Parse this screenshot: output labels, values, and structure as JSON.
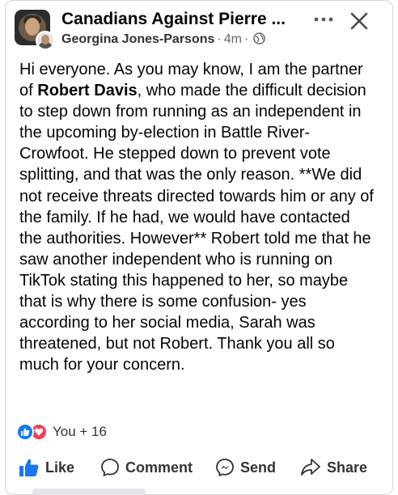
{
  "post": {
    "group_name": "Canadians Against Pierre ...",
    "author": "Georgina Jones-Parsons",
    "separator": "·",
    "time": "4m",
    "time_separator": "·",
    "privacy_icon": "globe-icon",
    "more_icon": "more-horizontal-icon",
    "close_icon": "close-icon",
    "text_before_bold": "Hi everyone. As you may know, I am the partner of ",
    "bold_name": "Robert Davis",
    "text_after_bold": ", who made the difficult decision to step down from running as an independent in the upcoming by-election in Battle River-Crowfoot. He stepped down to prevent vote splitting, and that was the only reason. **We did not receive threats directed towards him or any of the family. If he had, we would have contacted the authorities. However** Robert told me that he saw another independent who is running on TikTok stating this happened to her, so maybe that is why there is some confusion- yes according to her social media, Sarah was threatened, but not Robert. Thank you all so much for your concern."
  },
  "reactions": {
    "icons": [
      "like-reaction-icon",
      "love-reaction-icon"
    ],
    "count_label": "You + 16"
  },
  "actions": {
    "like": "Like",
    "comment": "Comment",
    "send": "Send",
    "share": "Share"
  },
  "colors": {
    "accent": "#1877f2",
    "love": "#f33e58",
    "text": "#050505",
    "secondary_text": "#65676b"
  }
}
